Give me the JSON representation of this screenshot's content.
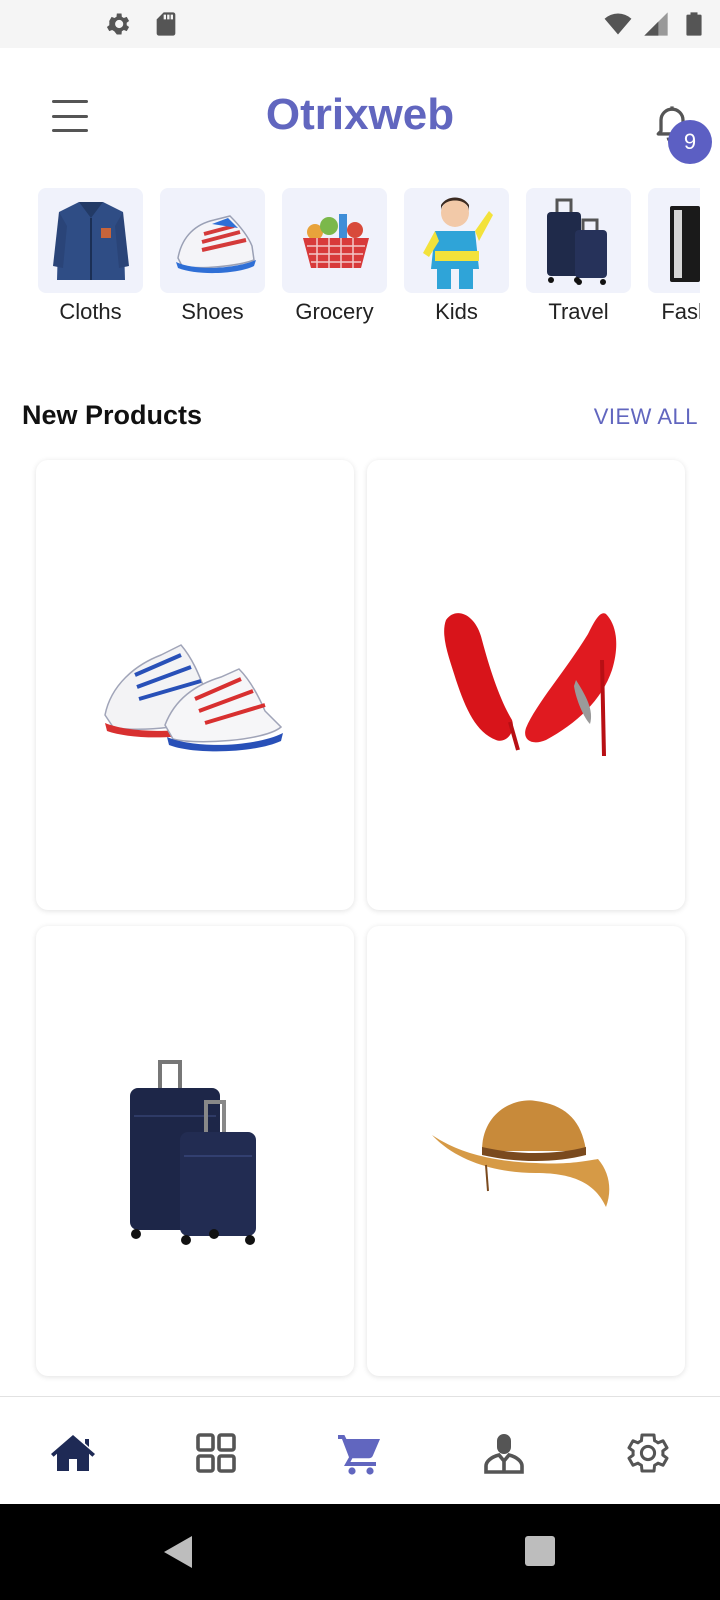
{
  "app": {
    "title": "Otrixweb"
  },
  "notifications": {
    "count": "9"
  },
  "categories": [
    {
      "label": "Cloths"
    },
    {
      "label": "Shoes"
    },
    {
      "label": "Grocery"
    },
    {
      "label": "Kids"
    },
    {
      "label": "Travel"
    },
    {
      "label": "Fashion"
    }
  ],
  "section": {
    "title": "New Products",
    "view_all_label": "VIEW ALL"
  },
  "products": [
    {
      "name": "sneakers"
    },
    {
      "name": "red-heels"
    },
    {
      "name": "luggage-set"
    },
    {
      "name": "straw-hat"
    }
  ],
  "bottom_nav": [
    "home",
    "categories",
    "cart",
    "profile",
    "settings"
  ],
  "colors": {
    "accent": "#6166bf",
    "badge": "#5c5fc3",
    "nav_active": "#1e2a55",
    "category_bg": "#f0f2fb"
  }
}
